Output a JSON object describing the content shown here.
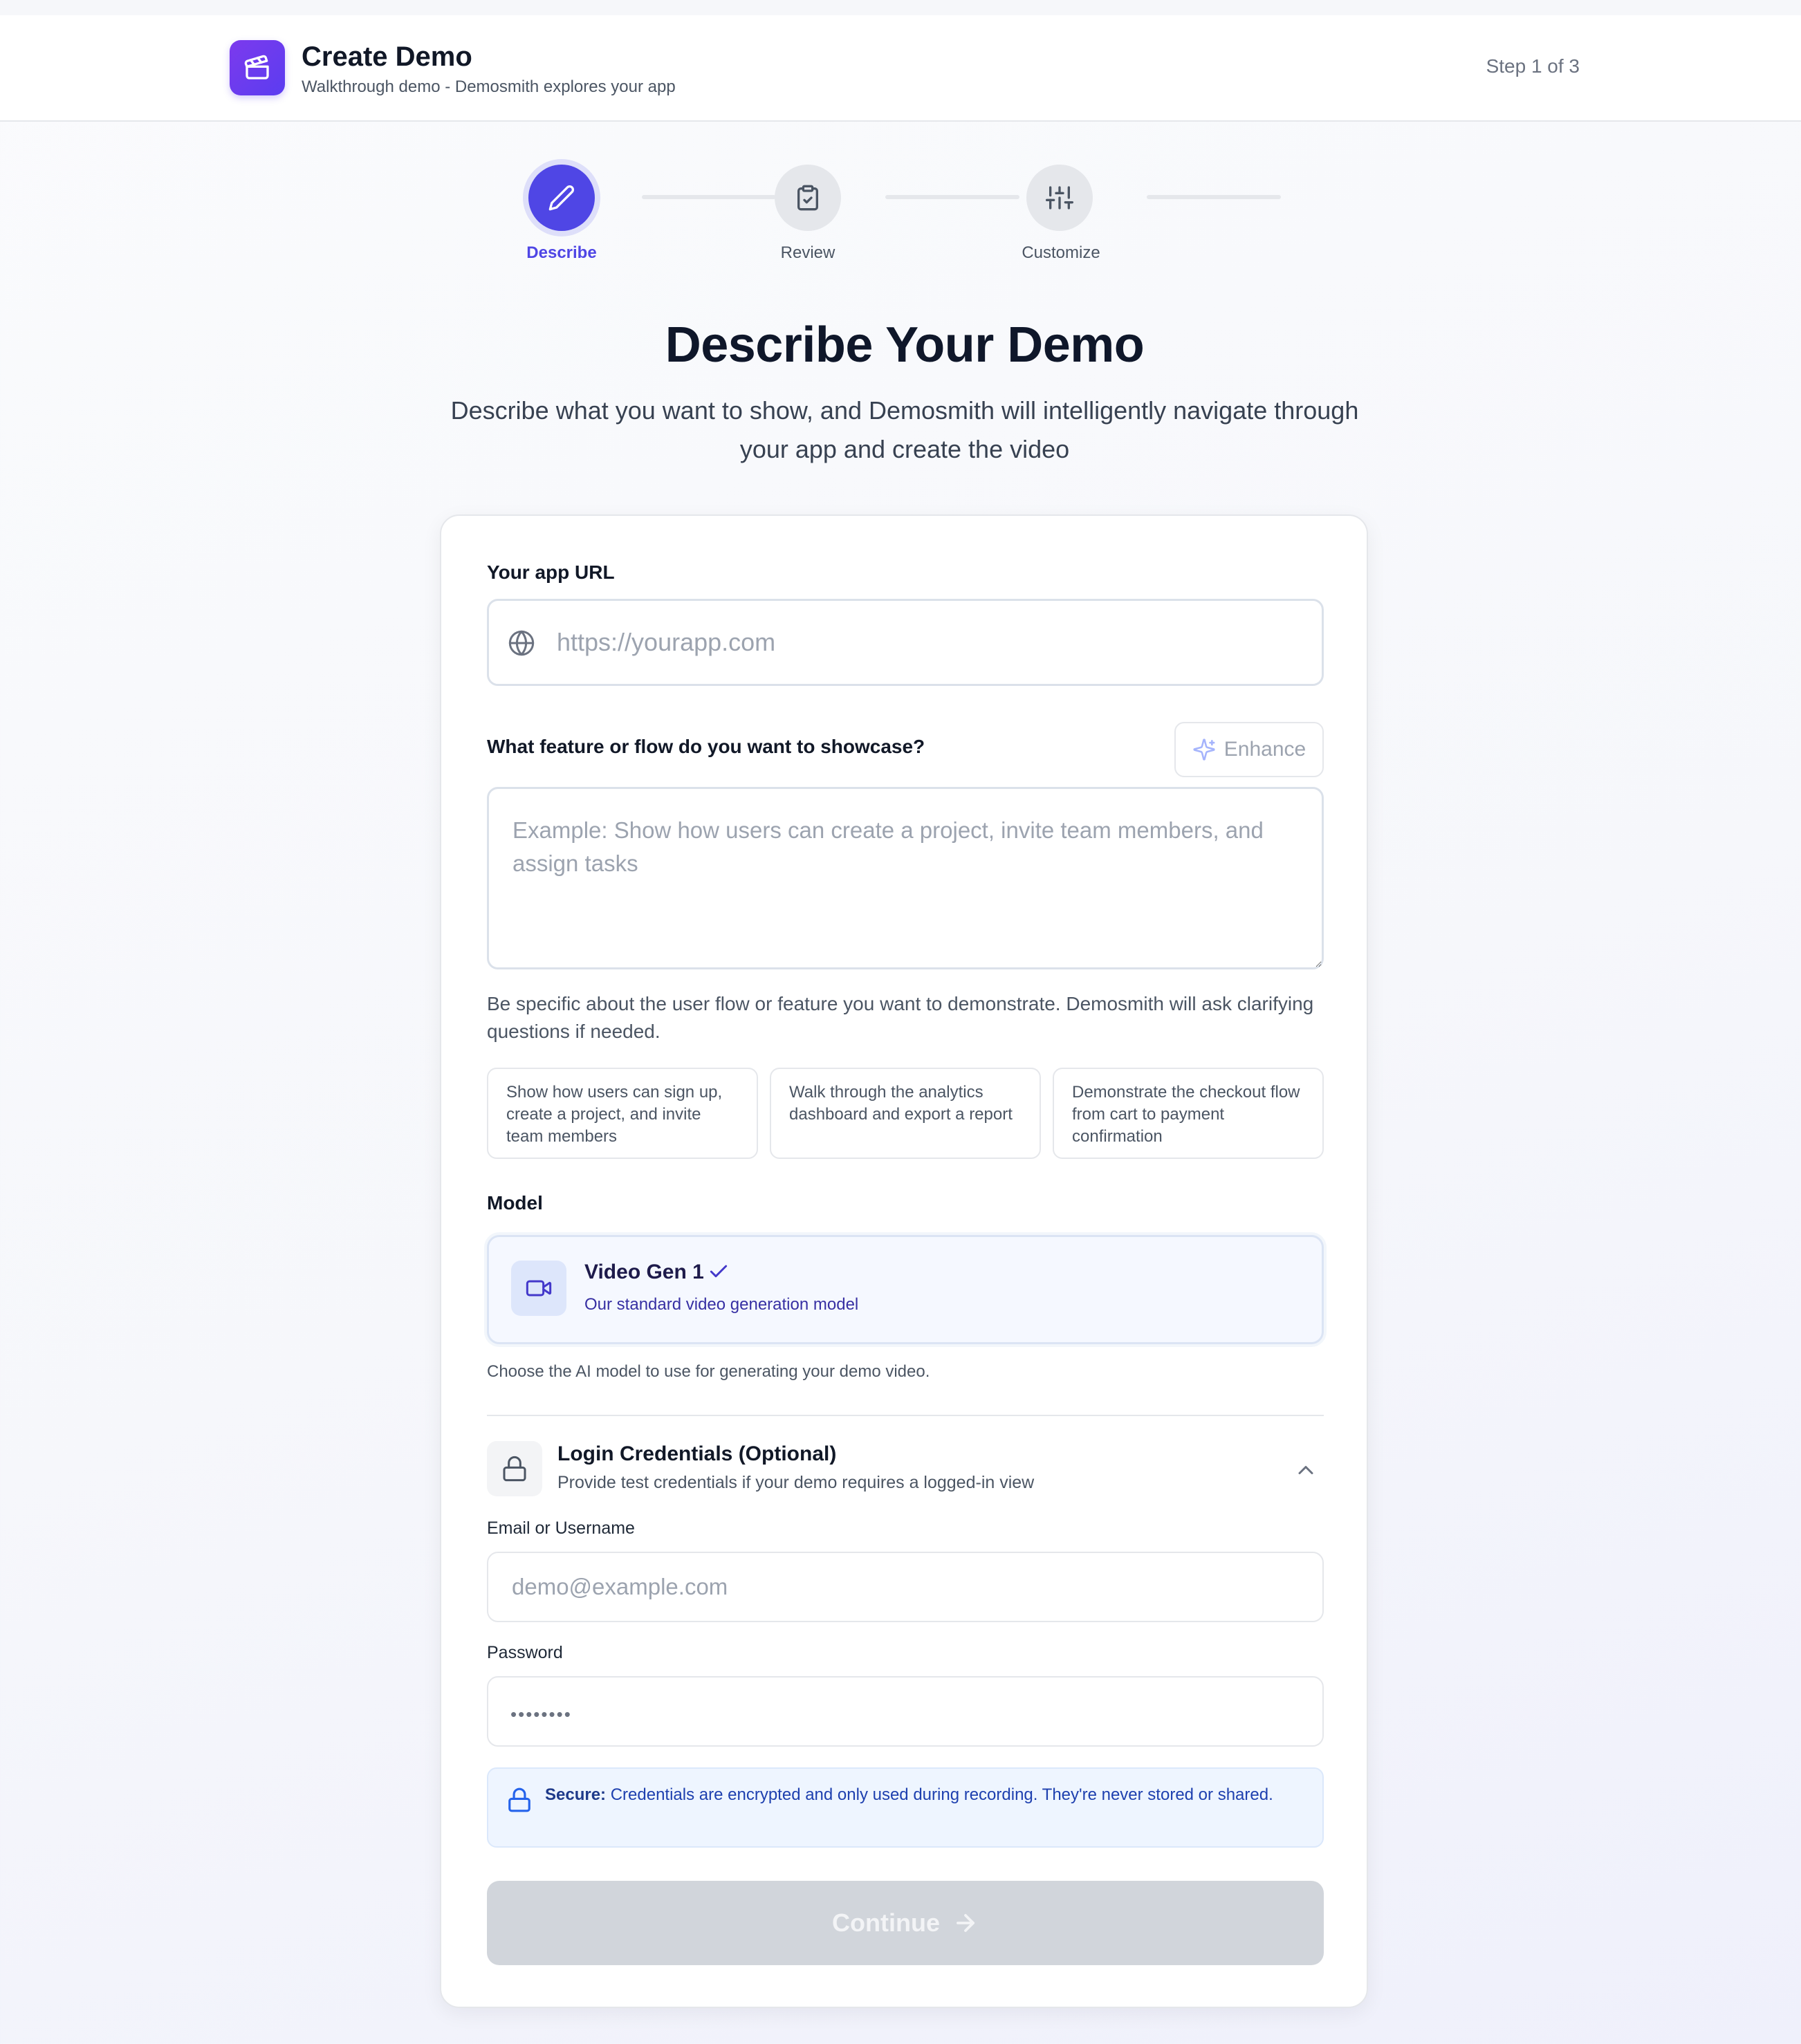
{
  "header": {
    "title": "Create Demo",
    "subtitle": "Walkthrough demo - Demosmith explores your app",
    "step_indicator": "Step 1 of 3"
  },
  "stepper": {
    "steps": [
      {
        "label": "Describe",
        "icon": "pencil-icon",
        "active": true
      },
      {
        "label": "Review",
        "icon": "clipboard-check-icon",
        "active": false
      },
      {
        "label": "Customize",
        "icon": "sliders-icon",
        "active": false
      }
    ]
  },
  "page": {
    "title": "Describe Your Demo",
    "description": "Describe what you want to show, and Demosmith will intelligently navigate through your app and create the video"
  },
  "form": {
    "url_label": "Your app URL",
    "url_placeholder": "https://yourapp.com",
    "url_value": "",
    "feature_label": "What feature or flow do you want to showcase?",
    "enhance_label": "Enhance",
    "feature_placeholder": "Example: Show how users can create a project, invite team members, and assign tasks",
    "feature_value": "",
    "feature_hint": "Be specific about the user flow or feature you want to demonstrate. Demosmith will ask clarifying questions if needed.",
    "suggestions": [
      "Show how users can sign up, create a project, and invite team members",
      "Walk through the analytics dashboard and export a report",
      "Demonstrate the checkout flow from cart to payment confirmation"
    ],
    "model_label": "Model",
    "model": {
      "name": "Video Gen 1",
      "description": "Our standard video generation model",
      "selected": true
    },
    "model_hint": "Choose the AI model to use for generating your demo video.",
    "credentials": {
      "title": "Login Credentials (Optional)",
      "subtitle": "Provide test credentials if your demo requires a logged-in view",
      "expanded": true,
      "email_label": "Email or Username",
      "email_placeholder": "demo@example.com",
      "password_label": "Password",
      "password_placeholder": "••••••••"
    },
    "secure_title": "Secure:",
    "secure_text": "Credentials are encrypted and only used during recording. They're never stored or shared.",
    "continue_label": "Continue",
    "continue_enabled": false
  },
  "colors": {
    "accent": "#4f46e5",
    "logo_gradient_start": "#7c3aed",
    "disabled_button": "#d1d5db",
    "secure_bg": "#eef5ff"
  }
}
